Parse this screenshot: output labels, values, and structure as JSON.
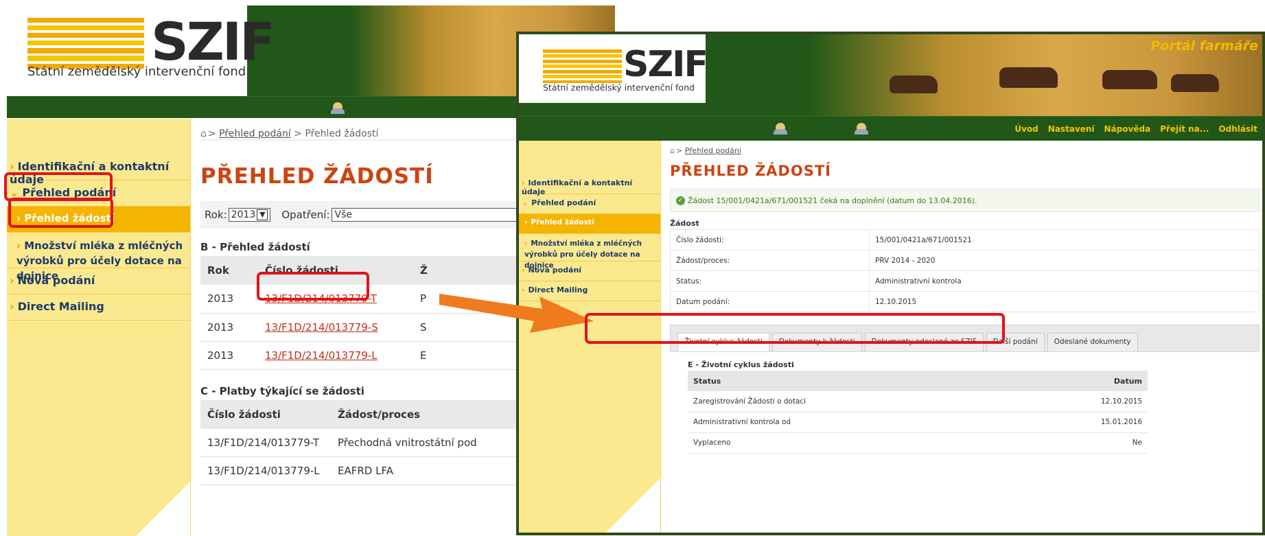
{
  "left_window": {
    "brand": "SZIF",
    "fund_name": "Státní zemědělský intervenční fond",
    "breadcrumb": {
      "home_link": "Přehled podání",
      "current": "Přehled žádostí"
    },
    "page_title": "PŘEHLED ŽÁDOSTÍ",
    "filter": {
      "year_label": "Rok:",
      "year_value": "2013",
      "measure_label": "Opatření:",
      "measure_value": "Vše"
    },
    "sidebar": [
      {
        "label": "Identifikační a kontaktní údaje"
      },
      {
        "label": "Přehled podání"
      },
      {
        "label": "Přehled žádostí"
      },
      {
        "label": "Množství mléka z mléčných výrobků pro účely dotace na dojnice"
      },
      {
        "label": "Nová podání"
      },
      {
        "label": "Direct Mailing"
      }
    ],
    "section_b": {
      "title": "B - Přehled žádostí",
      "headers": [
        "Rok",
        "Číslo žádosti",
        "Ž"
      ],
      "rows": [
        {
          "year": "2013",
          "number": "13/F1D/214/013779-T",
          "extra": "P"
        },
        {
          "year": "2013",
          "number": "13/F1D/214/013779-S",
          "extra": "S"
        },
        {
          "year": "2013",
          "number": "13/F1D/214/013779-L",
          "extra": "E"
        }
      ]
    },
    "section_c": {
      "title": "C - Platby týkající se žádosti",
      "headers": [
        "Číslo žádosti",
        "Žádost/proces"
      ],
      "rows": [
        {
          "number": "13/F1D/214/013779-T",
          "process": "Přechodná vnitrostátní pod"
        },
        {
          "number": "13/F1D/214/013779-L",
          "process": "EAFRD LFA"
        }
      ]
    }
  },
  "right_window": {
    "brand": "SZIF",
    "fund_name": "Státní zemědělský intervenční fond",
    "portal_name": "Portál farmáře",
    "nav": [
      "Úvod",
      "Nastavení",
      "Nápověda",
      "Přejít na...",
      "Odhlásit"
    ],
    "breadcrumb": {
      "home_link": "Přehled podání"
    },
    "page_title": "PŘEHLED ŽÁDOSTÍ",
    "sidebar": [
      {
        "label": "Identifikační a kontaktní údaje"
      },
      {
        "label": "Přehled podání"
      },
      {
        "label": "Přehled žádostí"
      },
      {
        "label": "Množství mléka z mléčných výrobků pro účely dotace na dojnice"
      },
      {
        "label": "Nová podání"
      },
      {
        "label": "Direct Mailing"
      }
    ],
    "notice": "Žádost 15/001/0421a/671/001521 čeká na doplnění (datum do 13.04.2016).",
    "zadost": {
      "title": "Žádost",
      "rows": [
        {
          "label": "Číslo žádosti:",
          "value": "15/001/0421a/671/001521"
        },
        {
          "label": "Žádost/proces:",
          "value": "PRV 2014 - 2020"
        },
        {
          "label": "Status:",
          "value": "Administrativní kontrola"
        },
        {
          "label": "Datum podání:",
          "value": "12.10.2015"
        }
      ]
    },
    "tabs": [
      "Životní cyklus žádosti",
      "Dokumenty k žádosti",
      "Dokumenty odeslané ze SZIF",
      "Další podání",
      "Odeslané dokumenty"
    ],
    "lifecycle": {
      "title": "E - Životní cyklus žádosti",
      "headers": [
        "Status",
        "Datum"
      ],
      "rows": [
        {
          "status": "Zaregistrování Žádosti o dotaci",
          "date": "12.10.2015"
        },
        {
          "status": "Administrativní kontrola od",
          "date": "15.01.2016"
        },
        {
          "status": "Vyplaceno",
          "date": "Ne"
        }
      ]
    }
  },
  "colors": {
    "header_green": "#215718",
    "accent_yellow": "#f6c500",
    "sidebar_bg": "#fbe98f",
    "active_item": "#f5b400",
    "title_orange": "#cc4411",
    "highlight_red": "#e0141c",
    "arrow_orange": "#f07a1e"
  }
}
